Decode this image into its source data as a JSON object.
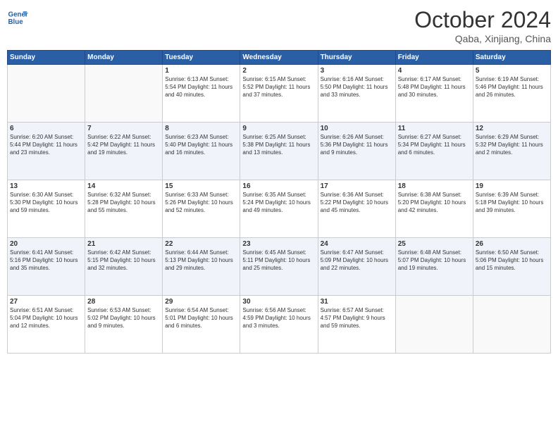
{
  "header": {
    "logo_line1": "General",
    "logo_line2": "Blue",
    "month": "October 2024",
    "location": "Qaba, Xinjiang, China"
  },
  "weekdays": [
    "Sunday",
    "Monday",
    "Tuesday",
    "Wednesday",
    "Thursday",
    "Friday",
    "Saturday"
  ],
  "weeks": [
    [
      {
        "day": "",
        "text": ""
      },
      {
        "day": "",
        "text": ""
      },
      {
        "day": "1",
        "text": "Sunrise: 6:13 AM\nSunset: 5:54 PM\nDaylight: 11 hours\nand 40 minutes."
      },
      {
        "day": "2",
        "text": "Sunrise: 6:15 AM\nSunset: 5:52 PM\nDaylight: 11 hours\nand 37 minutes."
      },
      {
        "day": "3",
        "text": "Sunrise: 6:16 AM\nSunset: 5:50 PM\nDaylight: 11 hours\nand 33 minutes."
      },
      {
        "day": "4",
        "text": "Sunrise: 6:17 AM\nSunset: 5:48 PM\nDaylight: 11 hours\nand 30 minutes."
      },
      {
        "day": "5",
        "text": "Sunrise: 6:19 AM\nSunset: 5:46 PM\nDaylight: 11 hours\nand 26 minutes."
      }
    ],
    [
      {
        "day": "6",
        "text": "Sunrise: 6:20 AM\nSunset: 5:44 PM\nDaylight: 11 hours\nand 23 minutes."
      },
      {
        "day": "7",
        "text": "Sunrise: 6:22 AM\nSunset: 5:42 PM\nDaylight: 11 hours\nand 19 minutes."
      },
      {
        "day": "8",
        "text": "Sunrise: 6:23 AM\nSunset: 5:40 PM\nDaylight: 11 hours\nand 16 minutes."
      },
      {
        "day": "9",
        "text": "Sunrise: 6:25 AM\nSunset: 5:38 PM\nDaylight: 11 hours\nand 13 minutes."
      },
      {
        "day": "10",
        "text": "Sunrise: 6:26 AM\nSunset: 5:36 PM\nDaylight: 11 hours\nand 9 minutes."
      },
      {
        "day": "11",
        "text": "Sunrise: 6:27 AM\nSunset: 5:34 PM\nDaylight: 11 hours\nand 6 minutes."
      },
      {
        "day": "12",
        "text": "Sunrise: 6:29 AM\nSunset: 5:32 PM\nDaylight: 11 hours\nand 2 minutes."
      }
    ],
    [
      {
        "day": "13",
        "text": "Sunrise: 6:30 AM\nSunset: 5:30 PM\nDaylight: 10 hours\nand 59 minutes."
      },
      {
        "day": "14",
        "text": "Sunrise: 6:32 AM\nSunset: 5:28 PM\nDaylight: 10 hours\nand 55 minutes."
      },
      {
        "day": "15",
        "text": "Sunrise: 6:33 AM\nSunset: 5:26 PM\nDaylight: 10 hours\nand 52 minutes."
      },
      {
        "day": "16",
        "text": "Sunrise: 6:35 AM\nSunset: 5:24 PM\nDaylight: 10 hours\nand 49 minutes."
      },
      {
        "day": "17",
        "text": "Sunrise: 6:36 AM\nSunset: 5:22 PM\nDaylight: 10 hours\nand 45 minutes."
      },
      {
        "day": "18",
        "text": "Sunrise: 6:38 AM\nSunset: 5:20 PM\nDaylight: 10 hours\nand 42 minutes."
      },
      {
        "day": "19",
        "text": "Sunrise: 6:39 AM\nSunset: 5:18 PM\nDaylight: 10 hours\nand 39 minutes."
      }
    ],
    [
      {
        "day": "20",
        "text": "Sunrise: 6:41 AM\nSunset: 5:16 PM\nDaylight: 10 hours\nand 35 minutes."
      },
      {
        "day": "21",
        "text": "Sunrise: 6:42 AM\nSunset: 5:15 PM\nDaylight: 10 hours\nand 32 minutes."
      },
      {
        "day": "22",
        "text": "Sunrise: 6:44 AM\nSunset: 5:13 PM\nDaylight: 10 hours\nand 29 minutes."
      },
      {
        "day": "23",
        "text": "Sunrise: 6:45 AM\nSunset: 5:11 PM\nDaylight: 10 hours\nand 25 minutes."
      },
      {
        "day": "24",
        "text": "Sunrise: 6:47 AM\nSunset: 5:09 PM\nDaylight: 10 hours\nand 22 minutes."
      },
      {
        "day": "25",
        "text": "Sunrise: 6:48 AM\nSunset: 5:07 PM\nDaylight: 10 hours\nand 19 minutes."
      },
      {
        "day": "26",
        "text": "Sunrise: 6:50 AM\nSunset: 5:06 PM\nDaylight: 10 hours\nand 15 minutes."
      }
    ],
    [
      {
        "day": "27",
        "text": "Sunrise: 6:51 AM\nSunset: 5:04 PM\nDaylight: 10 hours\nand 12 minutes."
      },
      {
        "day": "28",
        "text": "Sunrise: 6:53 AM\nSunset: 5:02 PM\nDaylight: 10 hours\nand 9 minutes."
      },
      {
        "day": "29",
        "text": "Sunrise: 6:54 AM\nSunset: 5:01 PM\nDaylight: 10 hours\nand 6 minutes."
      },
      {
        "day": "30",
        "text": "Sunrise: 6:56 AM\nSunset: 4:59 PM\nDaylight: 10 hours\nand 3 minutes."
      },
      {
        "day": "31",
        "text": "Sunrise: 6:57 AM\nSunset: 4:57 PM\nDaylight: 9 hours\nand 59 minutes."
      },
      {
        "day": "",
        "text": ""
      },
      {
        "day": "",
        "text": ""
      }
    ]
  ]
}
